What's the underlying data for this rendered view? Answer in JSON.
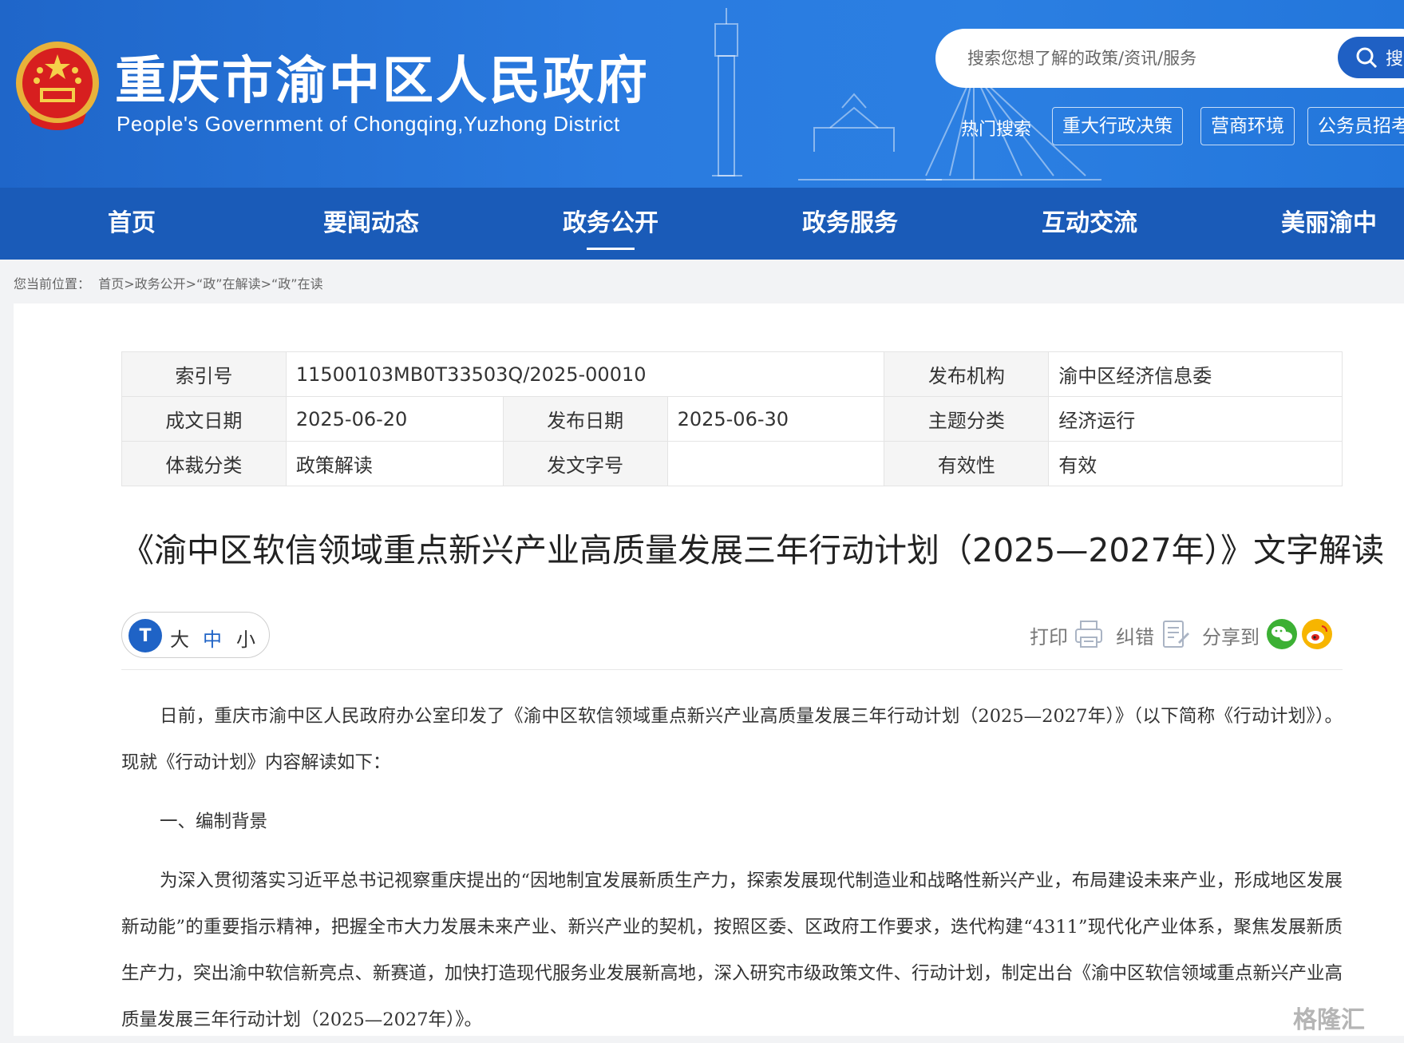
{
  "header": {
    "site_title": "重庆市渝中区人民政府",
    "site_subtitle": "People's Government of Chongqing,Yuzhong District",
    "search_placeholder": "搜索您想了解的政策/资讯/服务",
    "search_button": "搜",
    "hot_label": "热门搜索",
    "hot_tags": [
      "重大行政决策",
      "营商环境",
      "公务员招考"
    ]
  },
  "nav": [
    "首页",
    "要闻动态",
    "政务公开",
    "政务服务",
    "互动交流",
    "美丽渝中"
  ],
  "nav_active": "政务公开",
  "breadcrumb": {
    "label": "您当前位置：",
    "path": "首页>政务公开>“政”在解读>“政”在读"
  },
  "meta": {
    "index_no_label": "索引号",
    "index_no": "11500103MB0T33503Q/2025-00010",
    "publisher_label": "发布机构",
    "publisher": "渝中区经济信息委",
    "created_label": "成文日期",
    "created": "2025-06-20",
    "published_label": "发布日期",
    "published": "2025-06-30",
    "topic_label": "主题分类",
    "topic": "经济运行",
    "genre_label": "体裁分类",
    "genre": "政策解读",
    "docno_label": "发文字号",
    "docno": "",
    "validity_label": "有效性",
    "validity": "有效"
  },
  "doc_title": "《渝中区软信领域重点新兴产业高质量发展三年行动计划（2025—2027年）》文字解读",
  "font_switch": {
    "icon": "T",
    "large": "大",
    "medium": "中",
    "small": "小"
  },
  "tools": {
    "print": "打印",
    "error": "纠错",
    "share": "分享到"
  },
  "article": {
    "p1": "日前，重庆市渝中区人民政府办公室印发了《渝中区软信领域重点新兴产业高质量发展三年行动计划（2025—2027年）》（以下简称《行动计划》）。现就《行动计划》内容解读如下：",
    "h1": "一、编制背景",
    "p2": "为深入贯彻落实习近平总书记视察重庆提出的“因地制宜发展新质生产力，探索发展现代制造业和战略性新兴产业，布局建设未来产业，形成地区发展新动能”的重要指示精神，把握全市大力发展未来产业、新兴产业的契机，按照区委、区政府工作要求，迭代构建“4311”现代化产业体系，聚焦发展新质生产力，突出渝中软信新亮点、新赛道，加快打造现代服务业发展新高地，深入研究市级政策文件、行动计划，制定出台《渝中区软信领域重点新兴产业高质量发展三年行动计划（2025—2027年）》。"
  },
  "watermark": "格隆汇",
  "colors": {
    "header_blue": "#2a7be0",
    "nav_blue": "#1a5bb8",
    "accent": "#1f63c6"
  }
}
